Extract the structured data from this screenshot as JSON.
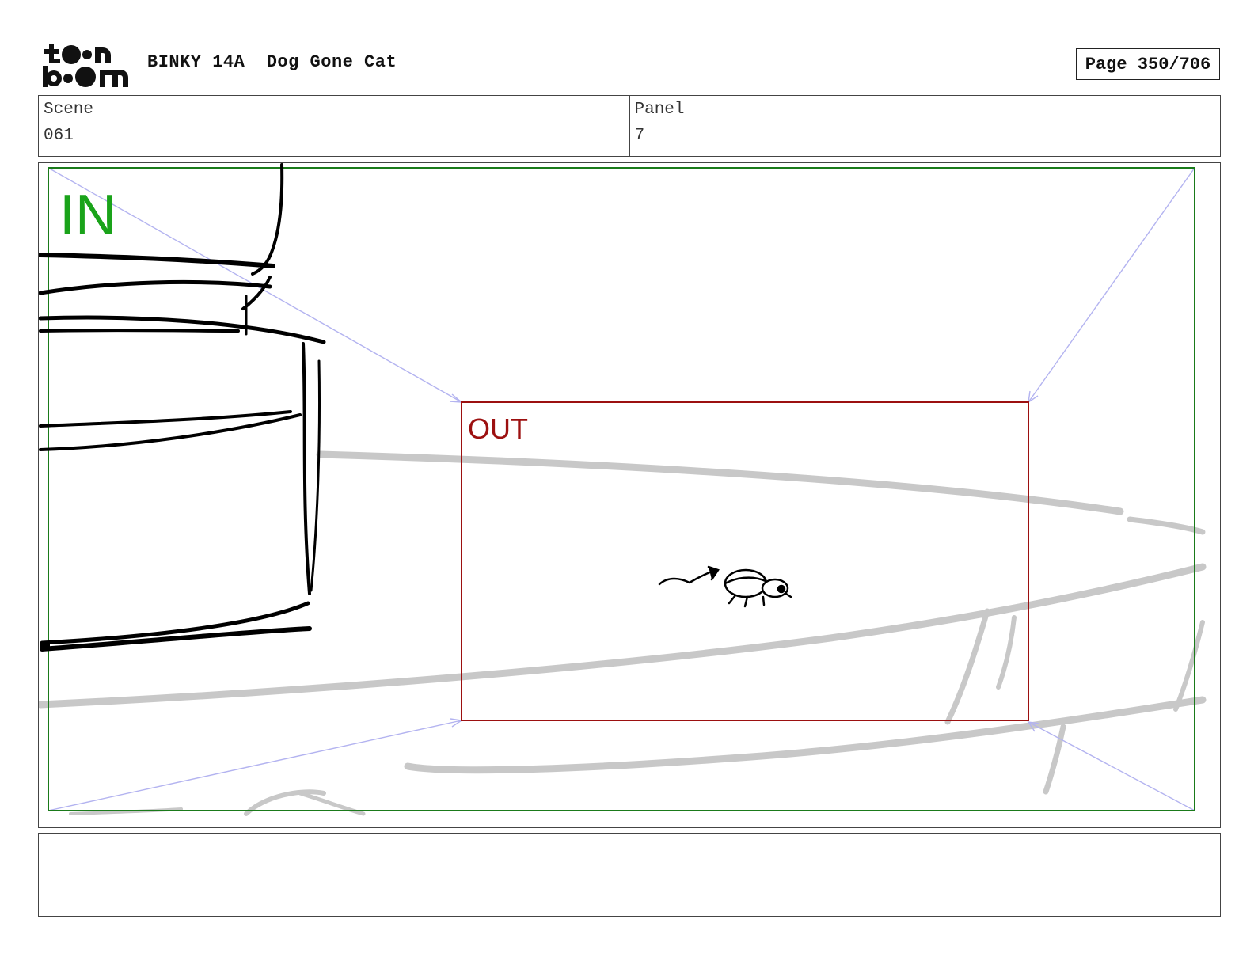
{
  "header": {
    "logo_alt": "toon boom",
    "project": "BINKY 14A",
    "episode": "Dog Gone Cat",
    "page_label": "Page 350/706"
  },
  "info": {
    "scene_label": "Scene",
    "scene_value": "061",
    "panel_label": "Panel",
    "panel_value": "7"
  },
  "panel": {
    "in_label": "IN",
    "out_label": "OUT",
    "colors": {
      "in_frame": "#1a7a1a",
      "in_text": "#1aa31a",
      "out_frame": "#9c1010",
      "camera_guides": "#b3b3f0",
      "background_sketch": "#c8c8c8",
      "ink": "#000000"
    }
  },
  "notes": {
    "text": ""
  }
}
